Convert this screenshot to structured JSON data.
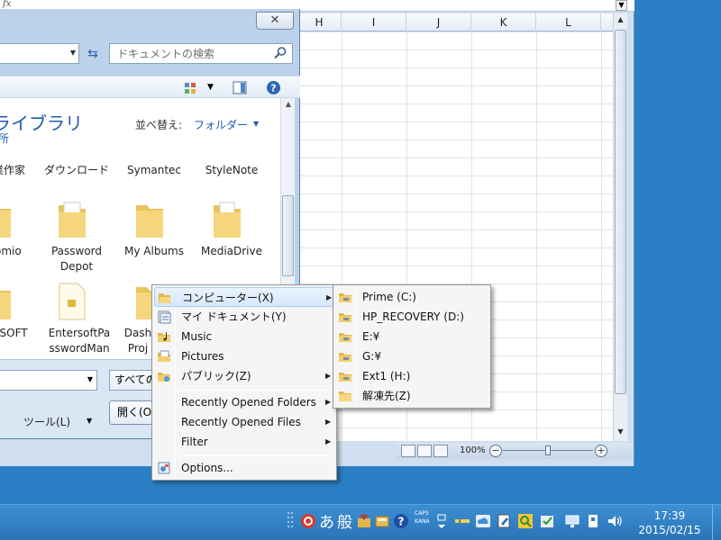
{
  "excel": {
    "formula_symbol": "fx",
    "columns": [
      "H",
      "I",
      "J",
      "K",
      "L"
    ],
    "zoom": "100%"
  },
  "dialog": {
    "search_placeholder": "ドキュメントの検索",
    "library_title": "ライブラリ",
    "library_subtitle": "所",
    "sort_label": "並べ替え:",
    "sort_value": "フォルダー",
    "row1": [
      "作業作家",
      "ダウンロード",
      "Symantec",
      "StyleNote"
    ],
    "row2": [
      "Promio",
      "Password Depot",
      "My Albums",
      "MediaDrive"
    ],
    "row3": [
      "CROSOFT",
      "EntersoftPasswordManager",
      "Dash Proj",
      ""
    ],
    "filetype_label": "すべての",
    "tools_label": "ツール(L)",
    "open_label": "開く(O)"
  },
  "menu_main": {
    "items": [
      {
        "label": "コンピューター(X)",
        "icon": "folder-open-icon",
        "submenu": true
      },
      {
        "label": "マイ ドキュメント(Y)",
        "icon": "documents-icon",
        "submenu": false
      },
      {
        "label": "Music",
        "icon": "music-folder-icon",
        "submenu": false
      },
      {
        "label": "Pictures",
        "icon": "pictures-folder-icon",
        "submenu": false
      },
      {
        "label": "パブリック(Z)",
        "icon": "public-folder-icon",
        "submenu": true
      },
      {
        "label": "Recently Opened Folders",
        "submenu": true
      },
      {
        "label": "Recently Opened Files",
        "submenu": true
      },
      {
        "label": "Filter",
        "submenu": true
      },
      {
        "label": "Options...",
        "icon": "options-icon",
        "submenu": false
      }
    ]
  },
  "menu_sub": {
    "items": [
      {
        "label": "Prime (C:)",
        "icon": "drive-icon"
      },
      {
        "label": "HP_RECOVERY (D:)",
        "icon": "drive-icon"
      },
      {
        "label": "E:¥",
        "icon": "drive-icon"
      },
      {
        "label": "G:¥",
        "icon": "drive-icon"
      },
      {
        "label": "Ext1 (H:)",
        "icon": "drive-icon"
      },
      {
        "label": "解凍先(Z)",
        "icon": "folder-icon"
      }
    ]
  },
  "taskbar": {
    "ime_mode": "あ",
    "ime_kanji": "般",
    "caps": "CAPS",
    "kana": "KANA",
    "time": "17:39",
    "date": "2015/02/15"
  },
  "colors": {
    "desktop": "#2b7fc4",
    "link_blue": "#1e5bb0",
    "menu_bg": "#f5f5f5",
    "highlight": "#d6e8fb"
  }
}
